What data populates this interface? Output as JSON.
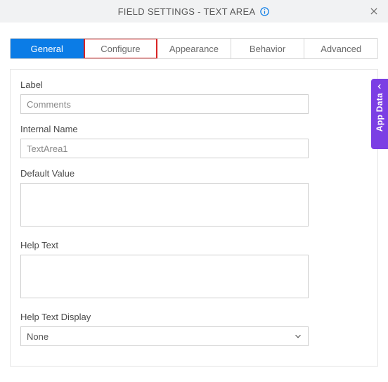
{
  "header": {
    "title": "FIELD SETTINGS - TEXT AREA"
  },
  "tabs": {
    "general": "General",
    "configure": "Configure",
    "appearance": "Appearance",
    "behavior": "Behavior",
    "advanced": "Advanced"
  },
  "form": {
    "label_label": "Label",
    "label_value": "Comments",
    "internal_name_label": "Internal Name",
    "internal_name_value": "TextArea1",
    "default_value_label": "Default Value",
    "default_value_value": "",
    "help_text_label": "Help Text",
    "help_text_value": "",
    "help_text_display_label": "Help Text Display",
    "help_text_display_value": "None"
  },
  "side": {
    "label": "App Data"
  }
}
